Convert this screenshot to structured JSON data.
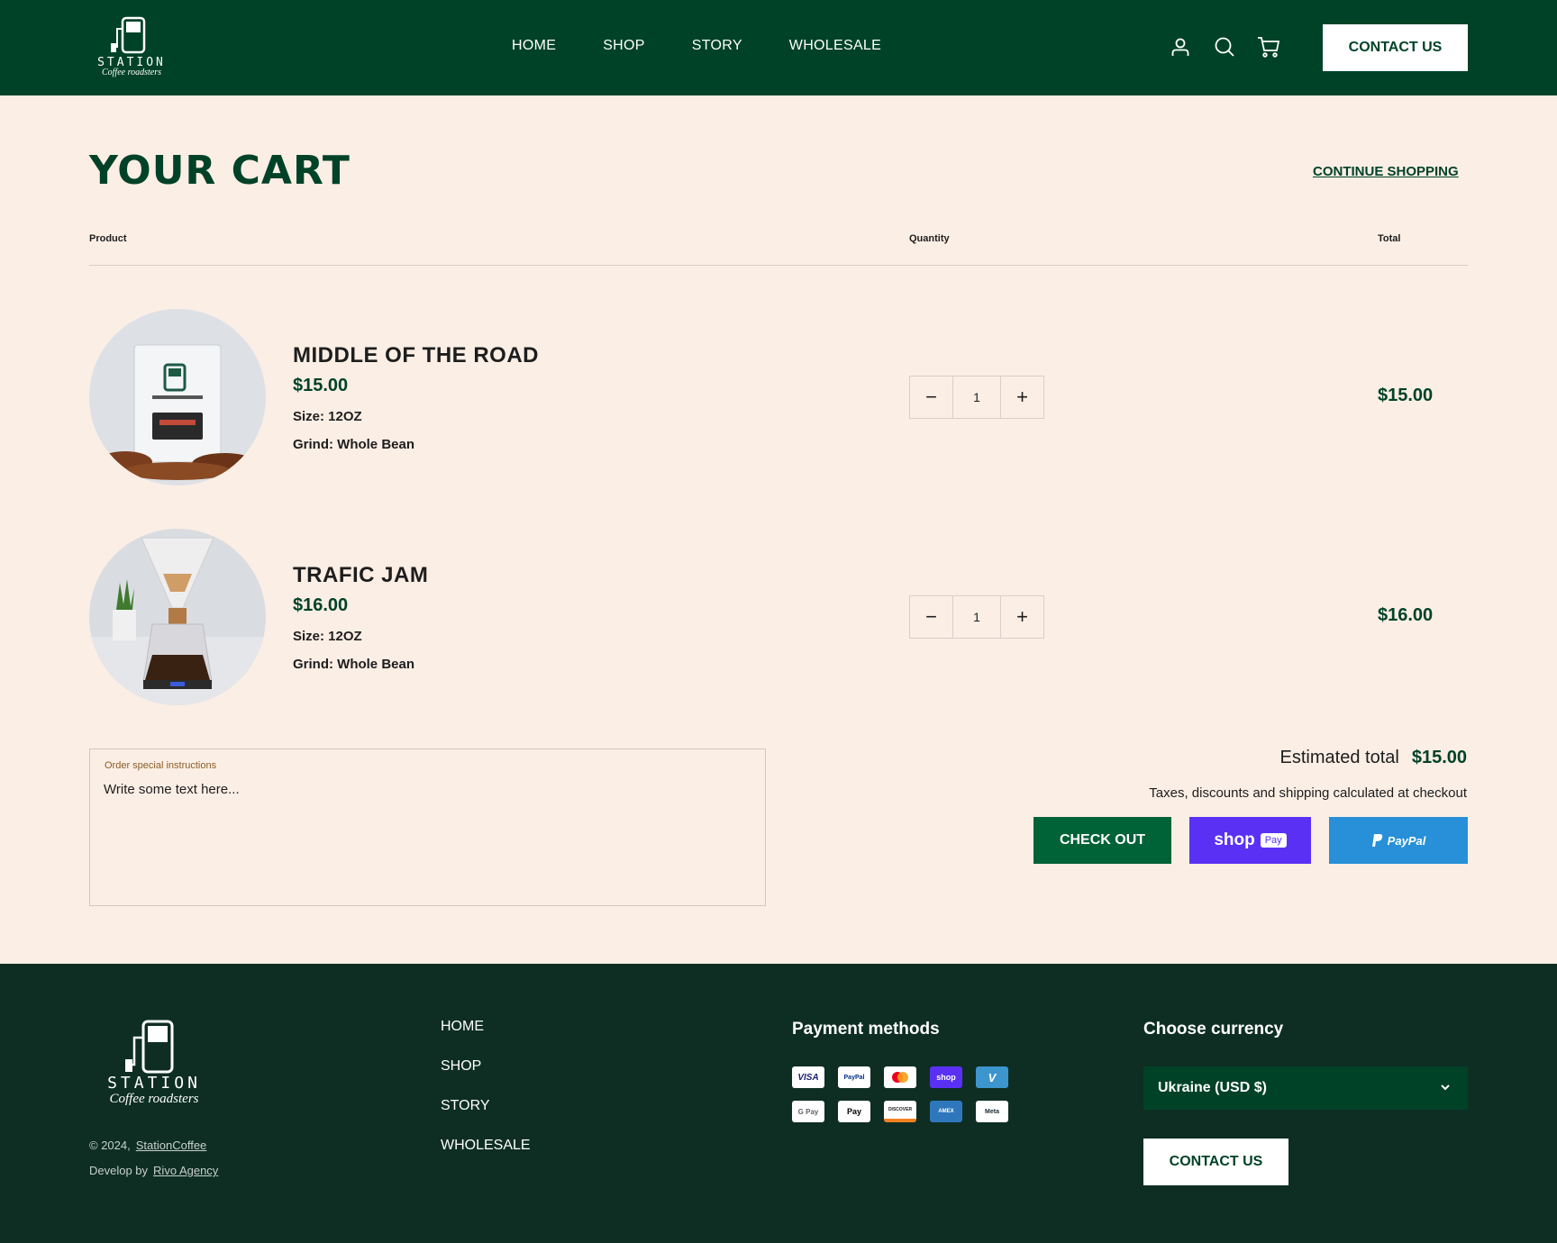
{
  "header": {
    "logo_brand": "STATION",
    "logo_sub": "Coffee roadsters",
    "nav": [
      "HOME",
      "SHOP",
      "STORY",
      "WHOLESALE"
    ],
    "contact_label": "CONTACT US",
    "icons": [
      "account-icon",
      "search-icon",
      "cart-icon"
    ]
  },
  "cart": {
    "title": "YOUR CART",
    "continue_label": "CONTINUE SHOPPING",
    "columns": {
      "product": "Product",
      "quantity": "Quantity",
      "total": "Total"
    },
    "items": [
      {
        "name": "MIDDLE OF THE ROAD",
        "price": "$15.00",
        "size": "Size: 12OZ",
        "grind": "Grind: Whole Bean",
        "qty": "1",
        "total": "$15.00"
      },
      {
        "name": "TRAFIC JAM",
        "price": "$16.00",
        "size": "Size: 12OZ",
        "grind": "Grind: Whole Bean",
        "qty": "1",
        "total": "$16.00"
      }
    ],
    "notes_label": "Order special instructions",
    "notes_placeholder": "Write some text here...",
    "estimated_label": "Estimated total",
    "estimated_value": "$15.00",
    "tax_note": "Taxes, discounts and shipping calculated at checkout",
    "checkout_label": "CHECK OUT",
    "shoppay_label": "shop",
    "shoppay_badge": "Pay",
    "paypal_label": "PayPal"
  },
  "footer": {
    "logo_brand": "STATION",
    "logo_sub": "Coffee roadsters",
    "copyright": "© 2024,",
    "copyright_link": "StationCoffee",
    "develop": "Develop by",
    "develop_link": "Rivo Agency",
    "nav": [
      "HOME",
      "SHOP",
      "STORY",
      "WHOLESALE"
    ],
    "payment_title": "Payment methods",
    "payment_cards": [
      "VISA",
      "PayPal",
      "",
      "shop",
      "V",
      "G Pay",
      " Pay",
      "DISCOVER",
      "AMEX",
      "Meta"
    ],
    "currency_title": "Choose currency",
    "currency_value": "Ukraine (USD $)",
    "contact_label": "CONTACT US"
  },
  "colors": {
    "brand_green": "#004228",
    "footer_bg": "#0e2e23",
    "page_bg": "#fbeee5",
    "shoppay": "#5a31f4",
    "paypal": "#2790d8"
  }
}
